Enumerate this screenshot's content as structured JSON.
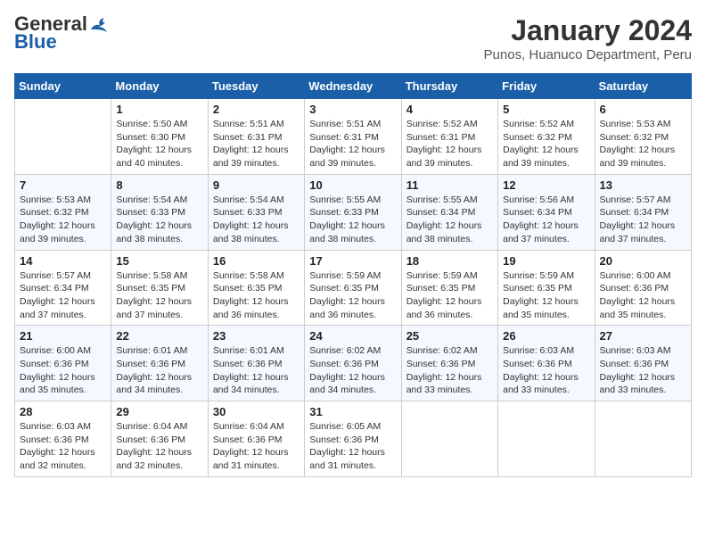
{
  "header": {
    "logo_general": "General",
    "logo_blue": "Blue",
    "month_year": "January 2024",
    "location": "Punos, Huanuco Department, Peru"
  },
  "days_of_week": [
    "Sunday",
    "Monday",
    "Tuesday",
    "Wednesday",
    "Thursday",
    "Friday",
    "Saturday"
  ],
  "weeks": [
    [
      {
        "day": "",
        "info": ""
      },
      {
        "day": "1",
        "info": "Sunrise: 5:50 AM\nSunset: 6:30 PM\nDaylight: 12 hours\nand 40 minutes."
      },
      {
        "day": "2",
        "info": "Sunrise: 5:51 AM\nSunset: 6:31 PM\nDaylight: 12 hours\nand 39 minutes."
      },
      {
        "day": "3",
        "info": "Sunrise: 5:51 AM\nSunset: 6:31 PM\nDaylight: 12 hours\nand 39 minutes."
      },
      {
        "day": "4",
        "info": "Sunrise: 5:52 AM\nSunset: 6:31 PM\nDaylight: 12 hours\nand 39 minutes."
      },
      {
        "day": "5",
        "info": "Sunrise: 5:52 AM\nSunset: 6:32 PM\nDaylight: 12 hours\nand 39 minutes."
      },
      {
        "day": "6",
        "info": "Sunrise: 5:53 AM\nSunset: 6:32 PM\nDaylight: 12 hours\nand 39 minutes."
      }
    ],
    [
      {
        "day": "7",
        "info": "Sunrise: 5:53 AM\nSunset: 6:32 PM\nDaylight: 12 hours\nand 39 minutes."
      },
      {
        "day": "8",
        "info": "Sunrise: 5:54 AM\nSunset: 6:33 PM\nDaylight: 12 hours\nand 38 minutes."
      },
      {
        "day": "9",
        "info": "Sunrise: 5:54 AM\nSunset: 6:33 PM\nDaylight: 12 hours\nand 38 minutes."
      },
      {
        "day": "10",
        "info": "Sunrise: 5:55 AM\nSunset: 6:33 PM\nDaylight: 12 hours\nand 38 minutes."
      },
      {
        "day": "11",
        "info": "Sunrise: 5:55 AM\nSunset: 6:34 PM\nDaylight: 12 hours\nand 38 minutes."
      },
      {
        "day": "12",
        "info": "Sunrise: 5:56 AM\nSunset: 6:34 PM\nDaylight: 12 hours\nand 37 minutes."
      },
      {
        "day": "13",
        "info": "Sunrise: 5:57 AM\nSunset: 6:34 PM\nDaylight: 12 hours\nand 37 minutes."
      }
    ],
    [
      {
        "day": "14",
        "info": "Sunrise: 5:57 AM\nSunset: 6:34 PM\nDaylight: 12 hours\nand 37 minutes."
      },
      {
        "day": "15",
        "info": "Sunrise: 5:58 AM\nSunset: 6:35 PM\nDaylight: 12 hours\nand 37 minutes."
      },
      {
        "day": "16",
        "info": "Sunrise: 5:58 AM\nSunset: 6:35 PM\nDaylight: 12 hours\nand 36 minutes."
      },
      {
        "day": "17",
        "info": "Sunrise: 5:59 AM\nSunset: 6:35 PM\nDaylight: 12 hours\nand 36 minutes."
      },
      {
        "day": "18",
        "info": "Sunrise: 5:59 AM\nSunset: 6:35 PM\nDaylight: 12 hours\nand 36 minutes."
      },
      {
        "day": "19",
        "info": "Sunrise: 5:59 AM\nSunset: 6:35 PM\nDaylight: 12 hours\nand 35 minutes."
      },
      {
        "day": "20",
        "info": "Sunrise: 6:00 AM\nSunset: 6:36 PM\nDaylight: 12 hours\nand 35 minutes."
      }
    ],
    [
      {
        "day": "21",
        "info": "Sunrise: 6:00 AM\nSunset: 6:36 PM\nDaylight: 12 hours\nand 35 minutes."
      },
      {
        "day": "22",
        "info": "Sunrise: 6:01 AM\nSunset: 6:36 PM\nDaylight: 12 hours\nand 34 minutes."
      },
      {
        "day": "23",
        "info": "Sunrise: 6:01 AM\nSunset: 6:36 PM\nDaylight: 12 hours\nand 34 minutes."
      },
      {
        "day": "24",
        "info": "Sunrise: 6:02 AM\nSunset: 6:36 PM\nDaylight: 12 hours\nand 34 minutes."
      },
      {
        "day": "25",
        "info": "Sunrise: 6:02 AM\nSunset: 6:36 PM\nDaylight: 12 hours\nand 33 minutes."
      },
      {
        "day": "26",
        "info": "Sunrise: 6:03 AM\nSunset: 6:36 PM\nDaylight: 12 hours\nand 33 minutes."
      },
      {
        "day": "27",
        "info": "Sunrise: 6:03 AM\nSunset: 6:36 PM\nDaylight: 12 hours\nand 33 minutes."
      }
    ],
    [
      {
        "day": "28",
        "info": "Sunrise: 6:03 AM\nSunset: 6:36 PM\nDaylight: 12 hours\nand 32 minutes."
      },
      {
        "day": "29",
        "info": "Sunrise: 6:04 AM\nSunset: 6:36 PM\nDaylight: 12 hours\nand 32 minutes."
      },
      {
        "day": "30",
        "info": "Sunrise: 6:04 AM\nSunset: 6:36 PM\nDaylight: 12 hours\nand 31 minutes."
      },
      {
        "day": "31",
        "info": "Sunrise: 6:05 AM\nSunset: 6:36 PM\nDaylight: 12 hours\nand 31 minutes."
      },
      {
        "day": "",
        "info": ""
      },
      {
        "day": "",
        "info": ""
      },
      {
        "day": "",
        "info": ""
      }
    ]
  ]
}
